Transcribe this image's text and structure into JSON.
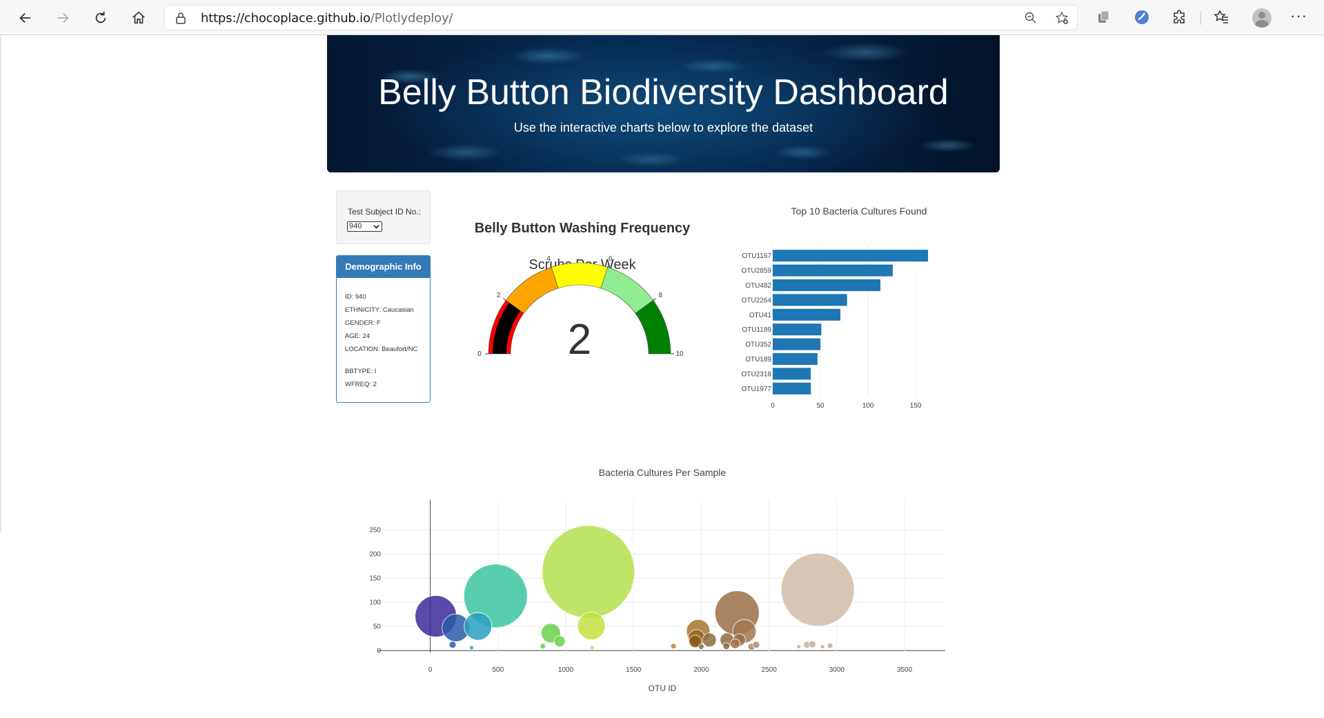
{
  "browser": {
    "url_host": "https://chocoplace.github.io",
    "url_path": "/Plotlydeploy/",
    "more_label": "···"
  },
  "jumbotron": {
    "title": "Belly Button Biodiversity Dashboard",
    "subtitle": "Use the interactive charts below to explore the dataset"
  },
  "selector": {
    "label": "Test Subject ID No.:",
    "selected": "940"
  },
  "demographics": {
    "header": "Demographic Info",
    "lines": [
      "ID: 940",
      "ETHNICITY: Caucasian",
      "GENDER: F",
      "AGE: 24",
      "LOCATION: Beaufort/NC",
      "BBTYPE: I",
      "WFREQ: 2"
    ]
  },
  "gauge": {
    "title": "Belly Button Washing Frequency",
    "subtitle": "Scrubs Per Week",
    "value": 2,
    "min": 0,
    "max": 10,
    "ticks": [
      0,
      2,
      4,
      6,
      8,
      10
    ],
    "bands": [
      {
        "from": 0,
        "to": 2,
        "color": "#ff0000"
      },
      {
        "from": 2,
        "to": 4,
        "color": "#ffa500"
      },
      {
        "from": 4,
        "to": 6,
        "color": "#ffff00"
      },
      {
        "from": 6,
        "to": 8,
        "color": "#90ee90"
      },
      {
        "from": 8,
        "to": 10,
        "color": "#008000"
      }
    ],
    "bar_color": "#000000"
  },
  "chart_data": [
    {
      "type": "bar",
      "orientation": "horizontal",
      "title": "Top 10 Bacteria Cultures Found",
      "categories": [
        "OTU1167",
        "OTU2859",
        "OTU482",
        "OTU2264",
        "OTU41",
        "OTU1189",
        "OTU352",
        "OTU189",
        "OTU2318",
        "OTU1977"
      ],
      "values": [
        163,
        126,
        113,
        78,
        71,
        51,
        50,
        47,
        40,
        40
      ],
      "xticks": [
        0,
        50,
        100,
        150
      ],
      "xlim": [
        0,
        168
      ],
      "color": "#1f77b4",
      "xlabel": "",
      "ylabel": ""
    },
    {
      "type": "scatter",
      "mode": "bubble",
      "title": "Bacteria Cultures Per Sample",
      "xlabel": "OTU ID",
      "ylabel": "",
      "xlim": [
        -390,
        3800
      ],
      "ylim": [
        -4,
        300
      ],
      "xticks": [
        0,
        500,
        1000,
        1500,
        2000,
        2500,
        3000,
        3500
      ],
      "yticks": [
        0,
        50,
        100,
        150,
        200,
        250
      ],
      "points": [
        {
          "x": 41,
          "y": 71,
          "size": 30,
          "color": "#3a2a99"
        },
        {
          "x": 189,
          "y": 47,
          "size": 20,
          "color": "#2d5aa8"
        },
        {
          "x": 352,
          "y": 50,
          "size": 20,
          "color": "#2aa0c0"
        },
        {
          "x": 482,
          "y": 113,
          "size": 46,
          "color": "#3cc6a0"
        },
        {
          "x": 165,
          "y": 12,
          "size": 5,
          "color": "#2d5aa8"
        },
        {
          "x": 305,
          "y": 6,
          "size": 3,
          "color": "#2aa0c0"
        },
        {
          "x": 890,
          "y": 36,
          "size": 14,
          "color": "#6ad04e"
        },
        {
          "x": 955,
          "y": 19,
          "size": 8,
          "color": "#6ad04e"
        },
        {
          "x": 830,
          "y": 9,
          "size": 4,
          "color": "#6ad04e"
        },
        {
          "x": 1167,
          "y": 163,
          "size": 67,
          "color": "#b4e04e"
        },
        {
          "x": 1189,
          "y": 51,
          "size": 20,
          "color": "#c4e040"
        },
        {
          "x": 1195,
          "y": 6,
          "size": 3,
          "color": "#d8d060"
        },
        {
          "x": 1795,
          "y": 9,
          "size": 4,
          "color": "#b8882e"
        },
        {
          "x": 1977,
          "y": 40,
          "size": 17,
          "color": "#a8752e"
        },
        {
          "x": 1965,
          "y": 26,
          "size": 12,
          "color": "#956420"
        },
        {
          "x": 1955,
          "y": 19,
          "size": 9,
          "color": "#885818"
        },
        {
          "x": 2000,
          "y": 8,
          "size": 4,
          "color": "#8e6b3e"
        },
        {
          "x": 2060,
          "y": 22,
          "size": 10,
          "color": "#8e6b3e"
        },
        {
          "x": 2264,
          "y": 78,
          "size": 32,
          "color": "#9b7048"
        },
        {
          "x": 2318,
          "y": 40,
          "size": 17,
          "color": "#a3784f"
        },
        {
          "x": 2190,
          "y": 22,
          "size": 10,
          "color": "#8e6b3e"
        },
        {
          "x": 2185,
          "y": 9,
          "size": 5,
          "color": "#8e6b3e"
        },
        {
          "x": 2250,
          "y": 14,
          "size": 7,
          "color": "#9b7048"
        },
        {
          "x": 2280,
          "y": 22,
          "size": 9,
          "color": "#9b7048"
        },
        {
          "x": 2370,
          "y": 8,
          "size": 5,
          "color": "#b08a64"
        },
        {
          "x": 2405,
          "y": 12,
          "size": 5,
          "color": "#b08a64"
        },
        {
          "x": 2859,
          "y": 126,
          "size": 53,
          "color": "#d3bca8"
        },
        {
          "x": 2720,
          "y": 8,
          "size": 3,
          "color": "#c7ad95"
        },
        {
          "x": 2780,
          "y": 12,
          "size": 5,
          "color": "#c7ad95"
        },
        {
          "x": 2820,
          "y": 13,
          "size": 5,
          "color": "#c7ad95"
        },
        {
          "x": 2895,
          "y": 8,
          "size": 3,
          "color": "#c7ad95"
        },
        {
          "x": 2950,
          "y": 10,
          "size": 4,
          "color": "#c7ad95"
        }
      ]
    }
  ]
}
